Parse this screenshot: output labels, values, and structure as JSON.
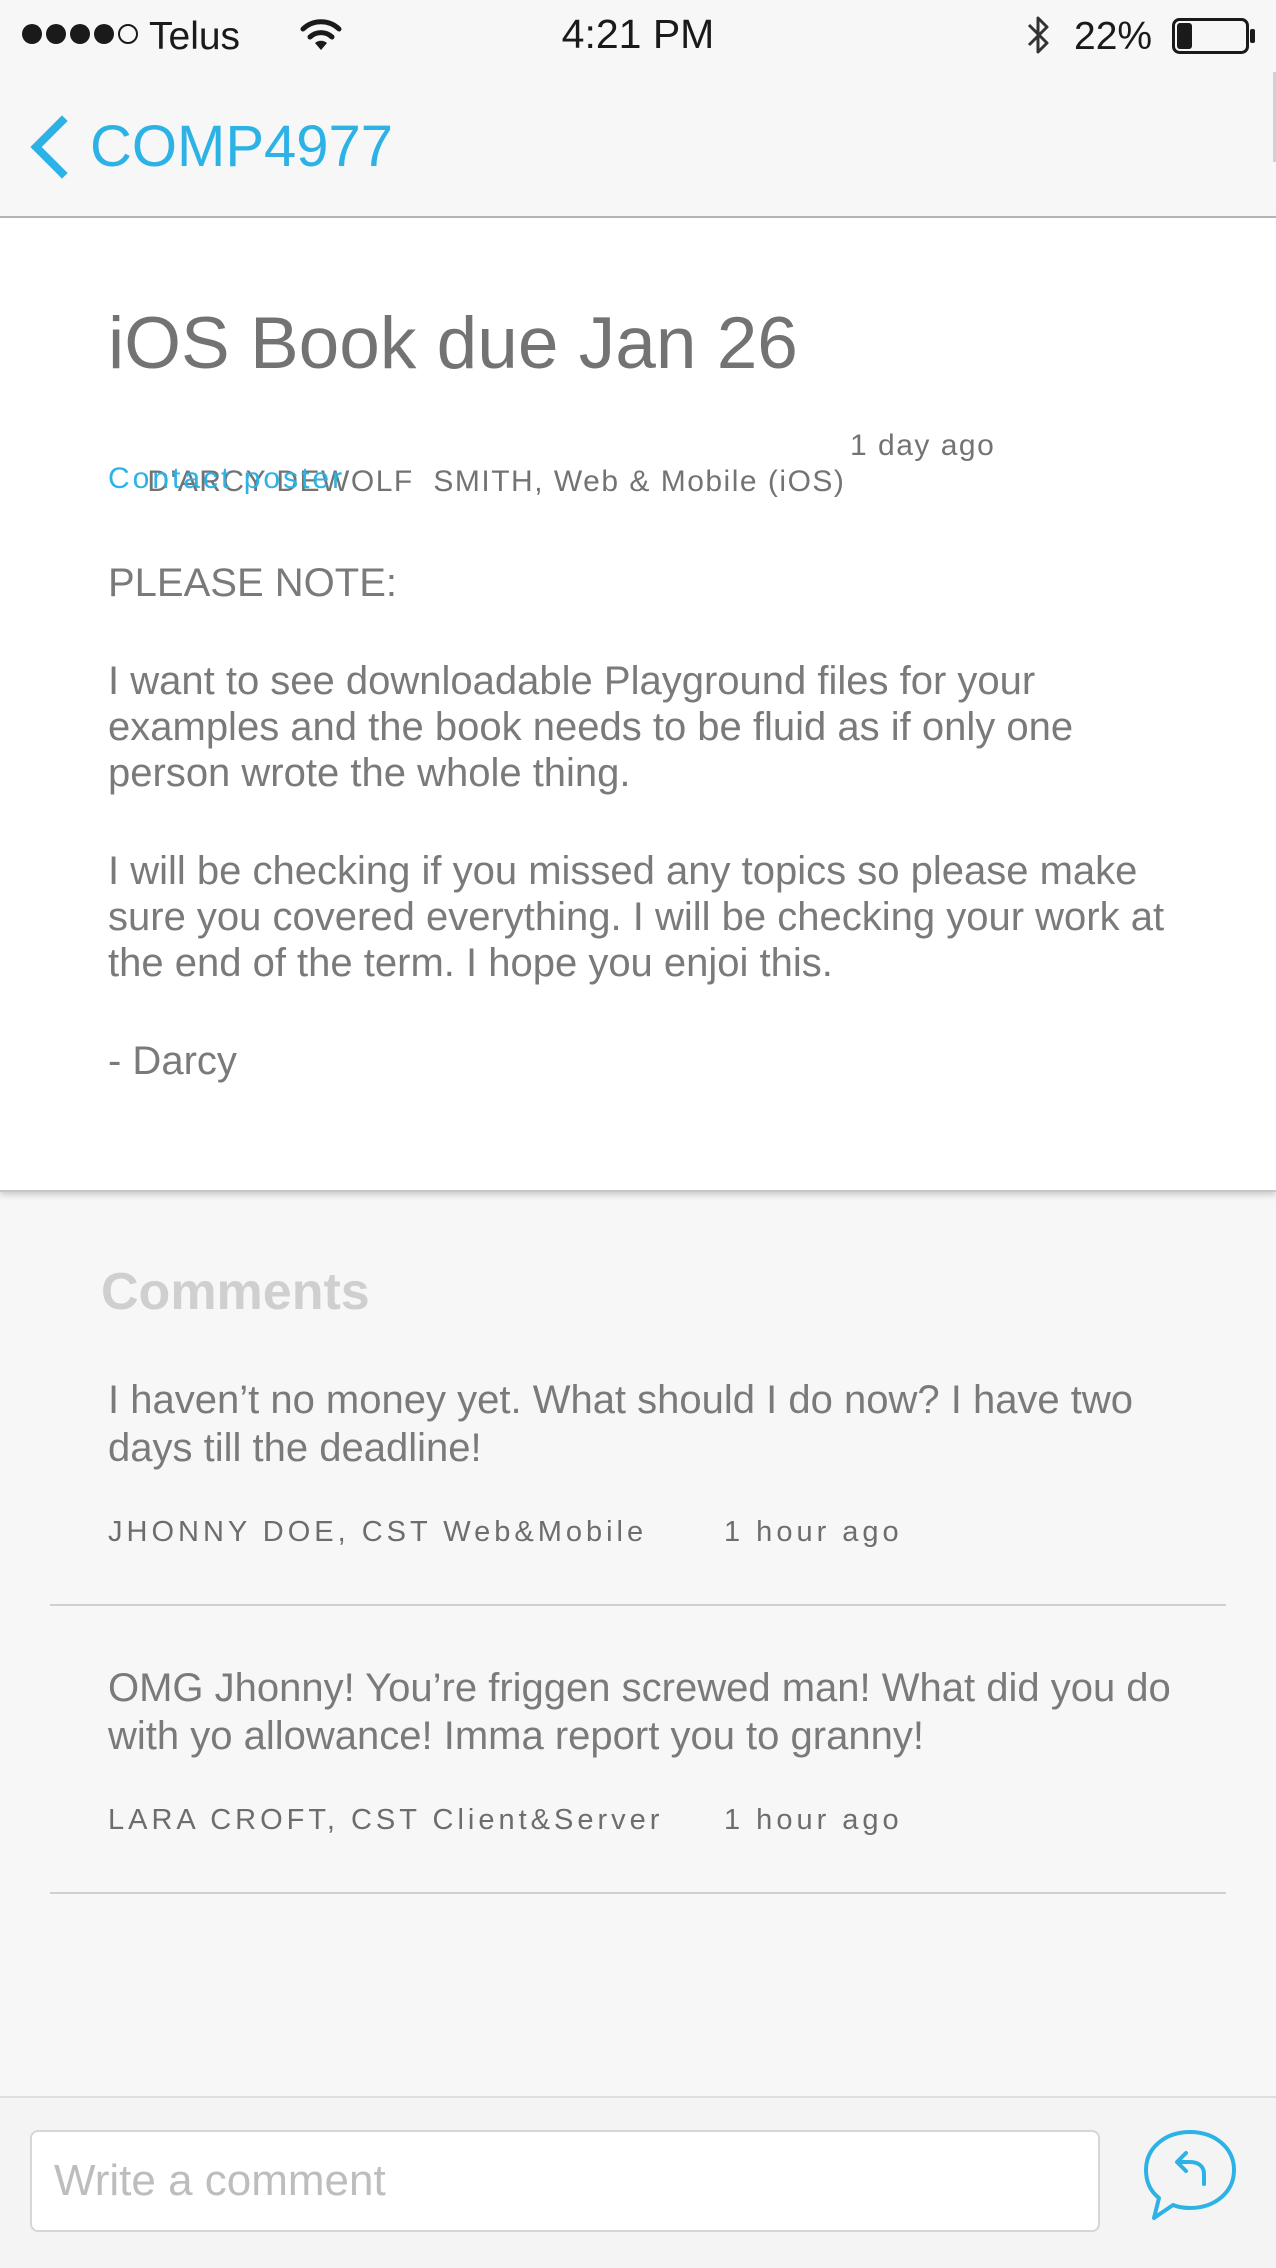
{
  "status_bar": {
    "carrier": "Telus",
    "time": "4:21 PM",
    "battery_percent": "22%",
    "signal_bars_filled": 4,
    "signal_bars_total": 5,
    "battery_level": 0.22
  },
  "nav": {
    "back_label": "COMP4977",
    "back_icon": "chevron-left-icon",
    "accent_color": "#2db2e6"
  },
  "post": {
    "title": "iOS Book due Jan 26",
    "author": "D'ARCY DEWOLF  SMITH, Web & Mobile (iOS)",
    "time": "1 day ago",
    "contact_label": "Contact poster",
    "body": [
      "PLEASE NOTE:",
      "I want to see downloadable Playground files for your examples and the book needs to be fluid as if only one person wrote the whole thing.",
      "I will be checking if you missed any topics so please make sure you covered everything. I will be checking your work at the end of the term. I hope you enjoi this.",
      "- Darcy"
    ]
  },
  "comments": {
    "heading": "Comments",
    "items": [
      {
        "text": "I haven’t no money yet. What should I do now? I have two days till the deadline!",
        "author": "JHONNY DOE, CST Web&Mobile",
        "time": "1 hour ago"
      },
      {
        "text": "OMG Jhonny! You’re friggen screwed man! What did you do with yo allowance! Imma report you to granny!",
        "author": "LARA CROFT, CST Client&Server",
        "time": "1 hour ago"
      }
    ]
  },
  "compose": {
    "placeholder": "Write a comment",
    "value": "",
    "reply_icon": "reply-bubble-icon"
  }
}
